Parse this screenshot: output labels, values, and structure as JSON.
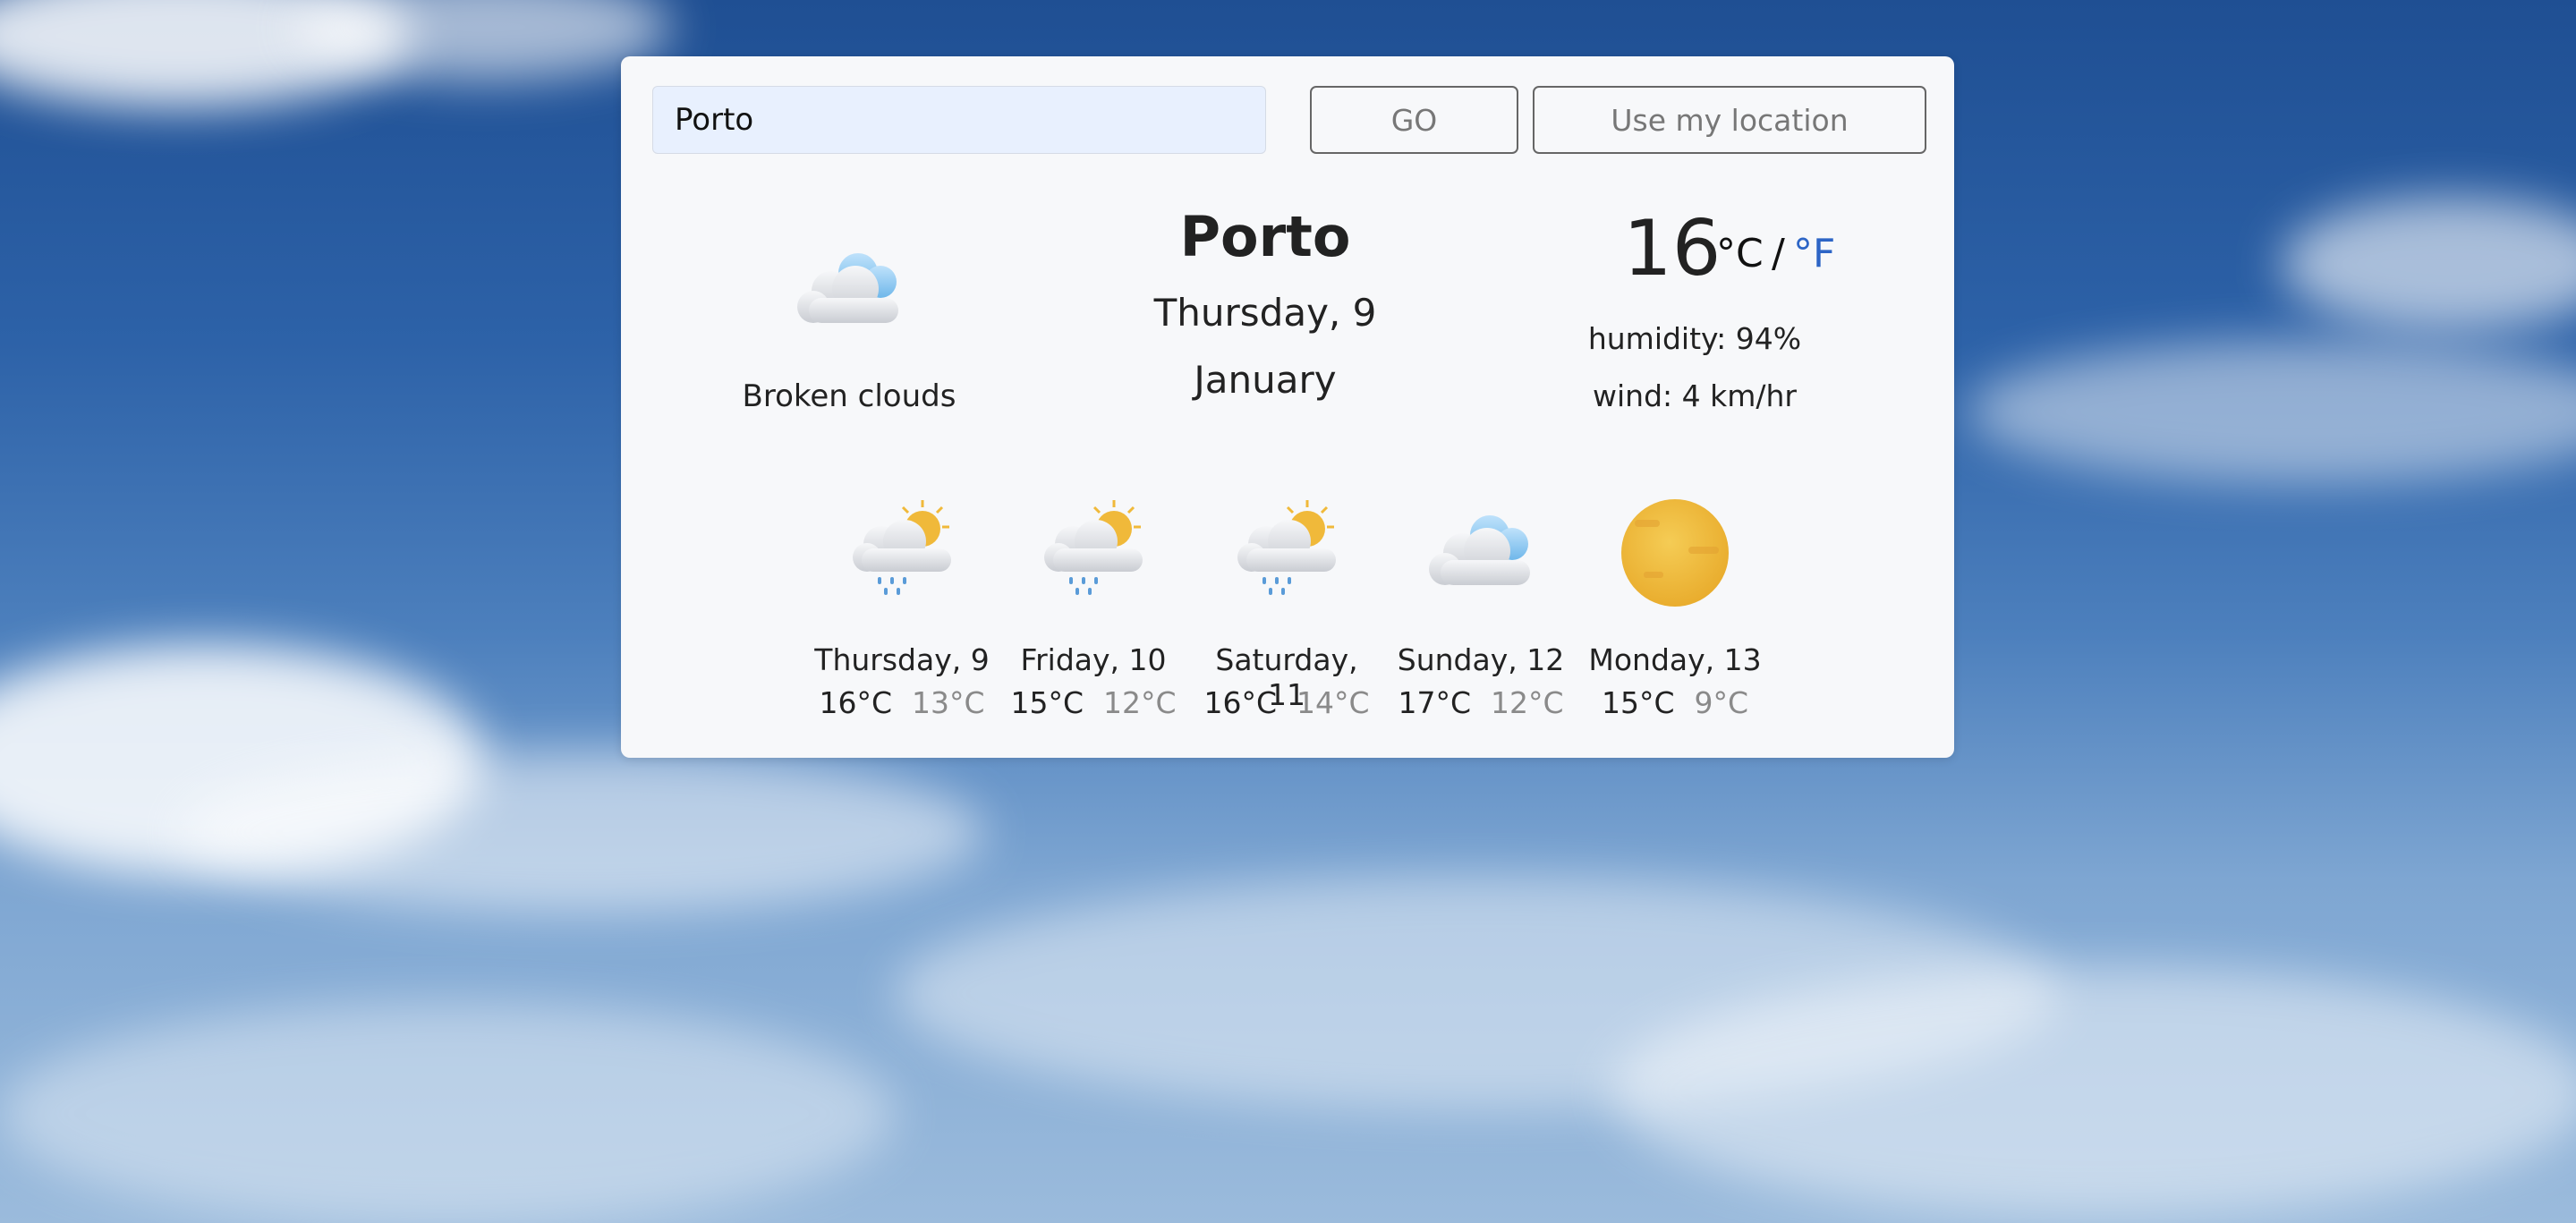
{
  "search": {
    "value": "Porto"
  },
  "buttons": {
    "go": "GO",
    "location": "Use my location"
  },
  "current": {
    "icon": "broken-clouds-icon",
    "description": "Broken clouds",
    "city": "Porto",
    "date_line1": "Thursday, 9",
    "date_line2": "January",
    "temperature": "16",
    "unit_c": "°C",
    "separator": "/",
    "unit_f": "°F",
    "humidity": "humidity: 94%",
    "wind": "wind: 4 km/hr"
  },
  "forecast": [
    {
      "day": "Thursday, 9",
      "max": "16°C",
      "min": "13°C",
      "icon": "sun-rain-cloud-icon"
    },
    {
      "day": "Friday, 10",
      "max": "15°C",
      "min": "12°C",
      "icon": "sun-rain-cloud-icon"
    },
    {
      "day": "Saturday, 11",
      "max": "16°C",
      "min": "14°C",
      "icon": "sun-rain-cloud-icon"
    },
    {
      "day": "Sunday, 12",
      "max": "17°C",
      "min": "12°C",
      "icon": "cloud-icon"
    },
    {
      "day": "Monday, 13",
      "max": "15°C",
      "min": "9°C",
      "icon": "sun-icon"
    }
  ],
  "colors": {
    "unit_active": "#111111",
    "unit_link": "#2d65c6",
    "min_temp": "#8a8a8a"
  }
}
